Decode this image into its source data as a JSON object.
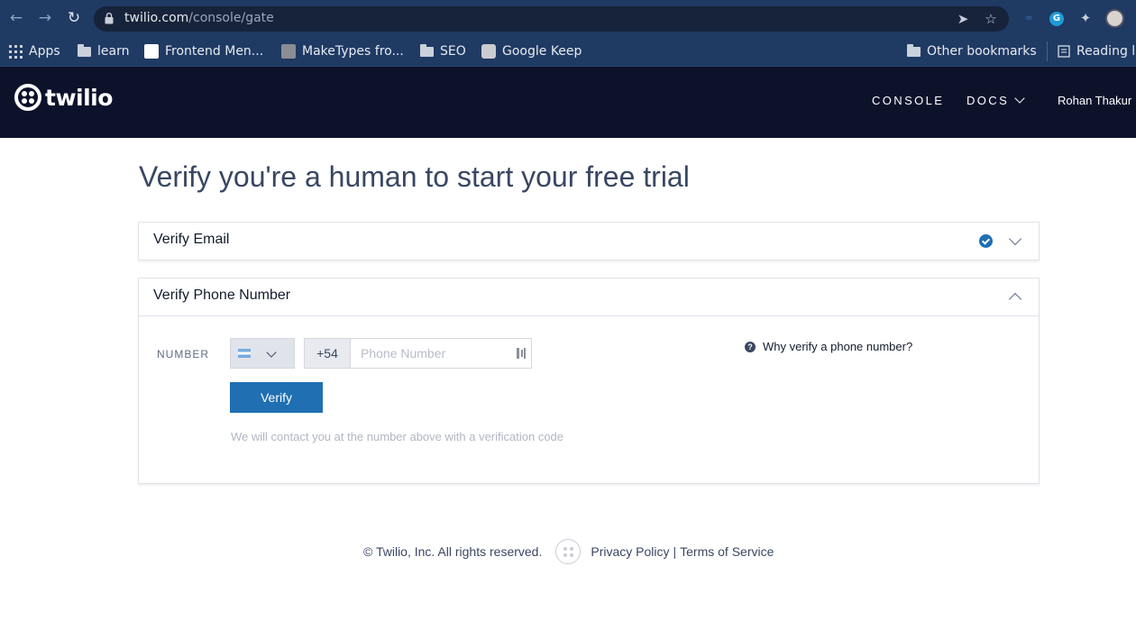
{
  "browser": {
    "url_host": "twilio.com",
    "url_path": "/console/gate",
    "bookmarks": [
      {
        "label": "Apps",
        "icon": "apps-grid-icon"
      },
      {
        "label": "learn",
        "icon": "folder-icon"
      },
      {
        "label": "Frontend Men...",
        "icon": "frontend-mentor-favicon"
      },
      {
        "label": "MakeTypes fro...",
        "icon": "maketypes-favicon"
      },
      {
        "label": "SEO",
        "icon": "folder-icon"
      },
      {
        "label": "Google Keep",
        "icon": "google-keep-favicon"
      }
    ],
    "other_bookmarks": "Other bookmarks",
    "reading_list": "Reading l"
  },
  "header": {
    "logo_text": "twilio",
    "nav": {
      "console": "CONSOLE",
      "docs": "DOCS"
    },
    "user": "Rohan Thakur"
  },
  "main": {
    "title": "Verify you're a human to start your free trial",
    "email_panel": {
      "title": "Verify Email",
      "status": "verified"
    },
    "phone_panel": {
      "title": "Verify Phone Number",
      "number_label": "NUMBER",
      "country_flag": "argentina-flag",
      "dial_code": "+54",
      "phone_placeholder": "Phone Number",
      "phone_value": "",
      "verify_button": "Verify",
      "hint": "We will contact you at the number above with a verification code",
      "why_link": "Why verify a phone number?"
    }
  },
  "footer": {
    "copyright": "© Twilio, Inc. All rights reserved.",
    "privacy": "Privacy Policy",
    "separator": "|",
    "terms": "Terms of Service"
  },
  "colors": {
    "header_bg": "#0d122b",
    "primary": "#1f6fb2",
    "chrome_bg": "#1f3a63"
  }
}
